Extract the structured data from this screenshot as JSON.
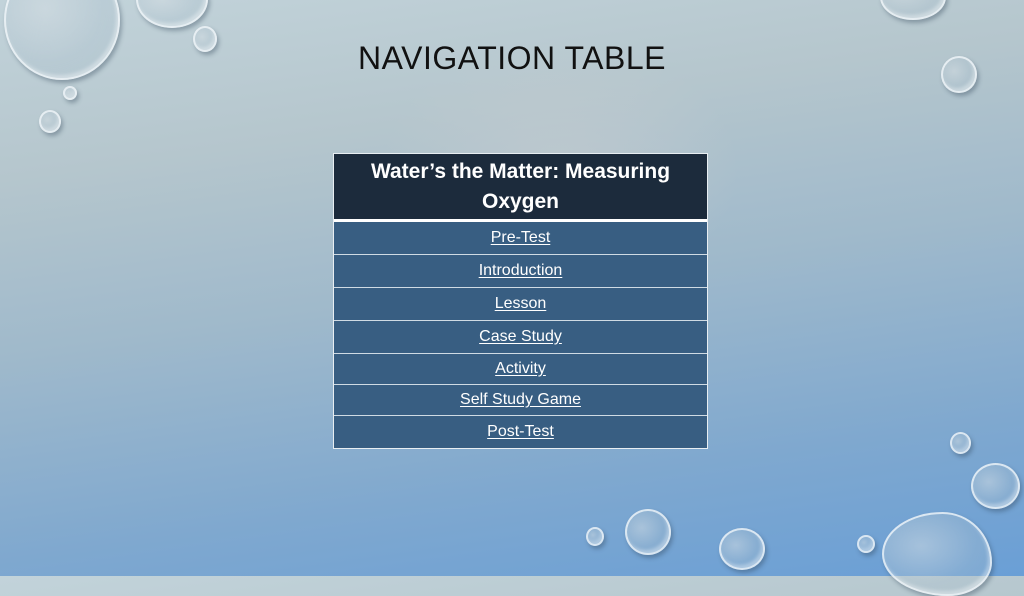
{
  "slide": {
    "title": "NAVIGATION TABLE"
  },
  "nav_table": {
    "header": "Water’s the Matter: Measuring Oxygen",
    "links": [
      {
        "label": "Pre-Test"
      },
      {
        "label": "Introduction"
      },
      {
        "label": "Lesson"
      },
      {
        "label": "Case Study"
      },
      {
        "label": "Activity"
      },
      {
        "label": "Self Study Game"
      },
      {
        "label": "Post-Test"
      }
    ]
  },
  "colors": {
    "header_bg": "#1c2b3c",
    "row_bg": "#385e82",
    "link_text": "#ffffff",
    "title_text": "#111111"
  }
}
